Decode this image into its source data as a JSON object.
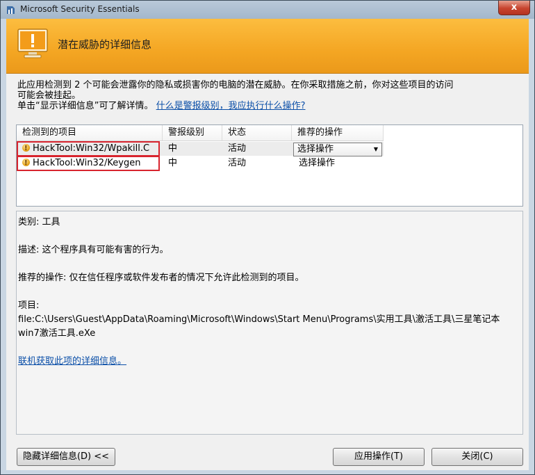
{
  "window": {
    "title": "Microsoft Security Essentials",
    "close_label": "x"
  },
  "header": {
    "title": "潜在威胁的详细信息"
  },
  "description": {
    "line1": "此应用检测到 2 个可能会泄露你的隐私或损害你的电脑的潜在威胁。在你采取措施之前，你对这些项目的访问",
    "line2": "可能会被挂起。",
    "line3": "单击“显示详细信息”可了解详情。",
    "help_link": "什么是警报级别，我应执行什么操作?"
  },
  "threat_table": {
    "columns": [
      "检测到的项目",
      "警报级别",
      "状态",
      "推荐的操作"
    ],
    "rows": [
      {
        "name": "HackTool:Win32/Wpakill.C",
        "level": "中",
        "status": "活动",
        "action": "选择操作"
      },
      {
        "name": "HackTool:Win32/Keygen",
        "level": "中",
        "status": "活动",
        "action": "选择操作"
      }
    ]
  },
  "details": {
    "category": "类别: 工具",
    "description": "描述: 这个程序具有可能有害的行为。",
    "recommendation": "推荐的操作: 仅在信任程序或软件发布者的情况下允许此检测到的项目。",
    "items_label": "项目:",
    "path_line1": "file:C:\\Users\\Guest\\AppData\\Roaming\\Microsoft\\Windows\\Start Menu\\Programs\\实用工具\\激活工具\\三星笔记本",
    "path_line2": "win7激活工具.eXe",
    "online_link": "联机获取此项的详细信息。"
  },
  "buttons": {
    "hide_details": "隐藏详细信息(D) <<",
    "apply": "应用操作(T)",
    "close": "关闭(C)"
  },
  "colors": {
    "header": "#f4a623",
    "link": "#0b4fa8",
    "highlight": "#d8242e"
  }
}
